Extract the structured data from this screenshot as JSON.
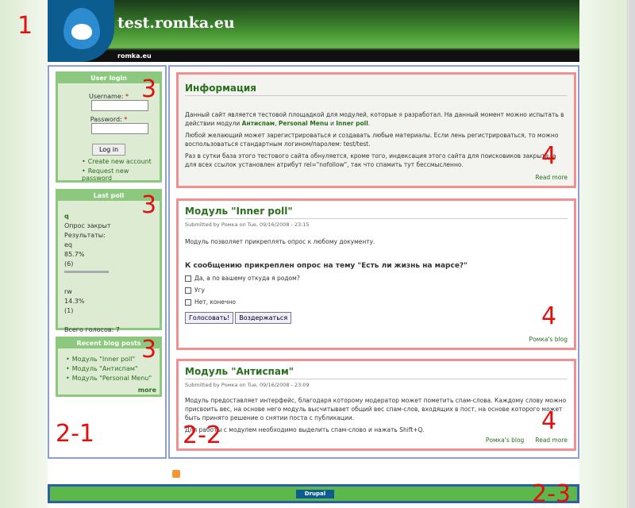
{
  "markers": [
    "1",
    "2-1",
    "2-2",
    "2-3",
    "3",
    "3",
    "3",
    "4",
    "4",
    "4"
  ],
  "header": {
    "site_name": "test.romka.eu",
    "primary_link": "romka.eu"
  },
  "login": {
    "title": "User login",
    "username_label": "Username:",
    "password_label": "Password:",
    "required_mark": "*",
    "button": "Log in",
    "create_account": "Create new account",
    "request_password": "Request new password"
  },
  "poll": {
    "title": "Last poll",
    "question": "q",
    "status": "Опрос закрыт",
    "results_label": "Результаты:",
    "options": [
      {
        "label": "eq",
        "percent": "85.7%",
        "votes": "(6)",
        "fraction": 0.857
      },
      {
        "label": "rw",
        "percent": "14.3%",
        "votes": "(1)",
        "fraction": 0.143
      }
    ],
    "total": "Всего голосов: 7"
  },
  "blog": {
    "title": "Recent blog posts",
    "items": [
      "Модуль \"Inner poll\"",
      "Модуль \"Антиспам\"",
      "Модуль \"Personal Menu\""
    ],
    "more": "more"
  },
  "nodes": [
    {
      "title": "Информация",
      "p1_before": "Данный сайт является тестовой площадкой для модулей, которые ",
      "p1_link1": "я",
      "p1_middle": " разработал. На данный момент можно испытать в действии модули ",
      "p1_link2": "Антиспам",
      "p1_sep1": ", ",
      "p1_link3": "Personal Menu",
      "p1_sep2": " и ",
      "p1_link4": "Inner poll",
      "p1_end": ".",
      "p2": "Любой желающий может зарегистрироваться и создавать любые материалы. Если лень регистрироваться, то можно воспользоваться стандартным логином/паролем: test/test.",
      "p3": "Раз в сутки база этого тестового сайта обнуляется, кроме того, индексация этого сайта для поисковиков закрыта, а для всех ссылок установлен атрибут rel=\"nofollow\", так что спамить тут бессмысленно.",
      "read_more": "Read more"
    },
    {
      "title": "Модуль \"Inner poll\"",
      "submitted": "Submitted by Ромка on Tue, 09/16/2008 - 23:15",
      "body": "Модуль позволяет прикреплять опрос к любому документу.",
      "question": "К сообщению прикреплен опрос на тему \"Есть ли жизнь на марсе?\"",
      "choices": [
        "Да, а по вашему откуда я родом?",
        "Угу",
        "Нет, конечно"
      ],
      "vote_button": "Голосовать!",
      "abstain_button": "Воздержаться",
      "blog_link": "Ромка's blog"
    },
    {
      "title": "Модуль \"Антиспам\"",
      "submitted": "Submitted by Ромка on Tue, 09/16/2008 - 23:09",
      "body": "Модуль предоставляет интерфейс, благодаря которому модератор может пометить спам-слова. Каждому слову можно присвоить вес, на основе него модуль высчитывает общий вес спам-слов, входящих в пост, на основе которого может быть принято решение о снятии поста с публикации.",
      "body2": "Для работы с модулем необходимо выделить спам-слово и нажать Shift+Q.",
      "blog_link": "Ромка's blog",
      "read_more": "Read more"
    }
  ],
  "footer": {
    "powered": "Drupal"
  },
  "colors": {
    "accent_green": "#2a6f1e",
    "block_border": "#8dc87f",
    "region_border": "#8f9fd0",
    "node_border": "#f09090",
    "marker_red": "#e01010"
  }
}
